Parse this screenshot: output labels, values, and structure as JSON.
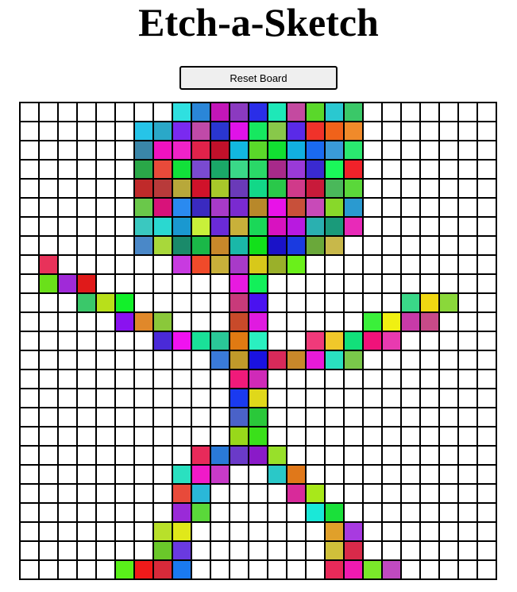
{
  "title": "Etch-a-Sketch",
  "reset_button": {
    "label": "Reset Board"
  },
  "board": {
    "size": 25,
    "default_color": "#ffffff",
    "painted": [
      [
        0,
        8,
        "#2fe0e0"
      ],
      [
        0,
        9,
        "#2a86d8"
      ],
      [
        0,
        10,
        "#c316b8"
      ],
      [
        0,
        11,
        "#8b3ac0"
      ],
      [
        0,
        12,
        "#2a2ee8"
      ],
      [
        0,
        13,
        "#1ee8b8"
      ],
      [
        0,
        14,
        "#c44aa0"
      ],
      [
        0,
        15,
        "#5ad82a"
      ],
      [
        0,
        16,
        "#2ac8d0"
      ],
      [
        0,
        17,
        "#3ac868"
      ],
      [
        1,
        6,
        "#26c4e8"
      ],
      [
        1,
        7,
        "#2aa8c8"
      ],
      [
        1,
        8,
        "#7a2af0"
      ],
      [
        1,
        9,
        "#c04aa8"
      ],
      [
        1,
        10,
        "#2a36d0"
      ],
      [
        1,
        11,
        "#e012e8"
      ],
      [
        1,
        12,
        "#16e860"
      ],
      [
        1,
        13,
        "#88c84a"
      ],
      [
        1,
        14,
        "#5a2ae8"
      ],
      [
        1,
        15,
        "#f0322a"
      ],
      [
        1,
        16,
        "#f0621a"
      ],
      [
        1,
        17,
        "#f08a2a"
      ],
      [
        2,
        6,
        "#3a86a8"
      ],
      [
        2,
        7,
        "#f012c0"
      ],
      [
        2,
        8,
        "#f022c8"
      ],
      [
        2,
        9,
        "#e0224a"
      ],
      [
        2,
        10,
        "#c0102a"
      ],
      [
        2,
        11,
        "#12b8e0"
      ],
      [
        2,
        12,
        "#5ad82a"
      ],
      [
        2,
        13,
        "#12e032"
      ],
      [
        2,
        14,
        "#12b0e0"
      ],
      [
        2,
        15,
        "#1a6af0"
      ],
      [
        2,
        16,
        "#3a9ad8"
      ],
      [
        2,
        17,
        "#2ae870"
      ],
      [
        3,
        6,
        "#2aa848"
      ],
      [
        3,
        7,
        "#e84a3a"
      ],
      [
        3,
        8,
        "#12e03a"
      ],
      [
        3,
        9,
        "#7a4ad0"
      ],
      [
        3,
        10,
        "#1aa868"
      ],
      [
        3,
        11,
        "#3ad888"
      ],
      [
        3,
        12,
        "#2ad868"
      ],
      [
        3,
        13,
        "#a82a8a"
      ],
      [
        3,
        14,
        "#9a3ad8"
      ],
      [
        3,
        15,
        "#3a2ad0"
      ],
      [
        3,
        16,
        "#1af85a"
      ],
      [
        3,
        17,
        "#f0222a"
      ],
      [
        4,
        6,
        "#c02a2a"
      ],
      [
        4,
        7,
        "#b83a3a"
      ],
      [
        4,
        8,
        "#b8a83a"
      ],
      [
        4,
        9,
        "#d0122a"
      ],
      [
        4,
        10,
        "#a8c82a"
      ],
      [
        4,
        11,
        "#6a3ab8"
      ],
      [
        4,
        12,
        "#12d888"
      ],
      [
        4,
        13,
        "#2ac84a"
      ],
      [
        4,
        14,
        "#d03a8a"
      ],
      [
        4,
        15,
        "#c81a3a"
      ],
      [
        4,
        16,
        "#4ab85a"
      ],
      [
        4,
        17,
        "#5ad83a"
      ],
      [
        5,
        6,
        "#6ac84a"
      ],
      [
        5,
        7,
        "#d8127a"
      ],
      [
        5,
        8,
        "#2a8af0"
      ],
      [
        5,
        9,
        "#3a2ac0"
      ],
      [
        5,
        10,
        "#a83ac8"
      ],
      [
        5,
        11,
        "#7a2ad0"
      ],
      [
        5,
        12,
        "#b8882a"
      ],
      [
        5,
        13,
        "#e812e8"
      ],
      [
        5,
        14,
        "#c8503a"
      ],
      [
        5,
        15,
        "#c84ab8"
      ],
      [
        5,
        16,
        "#88d82a"
      ],
      [
        5,
        17,
        "#2a9ad0"
      ],
      [
        6,
        6,
        "#3ac8c0"
      ],
      [
        6,
        7,
        "#2ad8d0"
      ],
      [
        6,
        8,
        "#1a98d0"
      ],
      [
        6,
        9,
        "#c8f03a"
      ],
      [
        6,
        10,
        "#6a2ad8"
      ],
      [
        6,
        11,
        "#c8b03a"
      ],
      [
        6,
        12,
        "#1ad858"
      ],
      [
        6,
        13,
        "#d812c0"
      ],
      [
        6,
        14,
        "#b81ae0"
      ],
      [
        6,
        15,
        "#2ab0b0"
      ],
      [
        6,
        16,
        "#1a9a7a"
      ],
      [
        6,
        17,
        "#e82ab8"
      ],
      [
        7,
        6,
        "#4a88c8"
      ],
      [
        7,
        7,
        "#a8d83a"
      ],
      [
        7,
        8,
        "#1a8a6a"
      ],
      [
        7,
        9,
        "#1ab848"
      ],
      [
        7,
        10,
        "#c8882a"
      ],
      [
        7,
        11,
        "#1ab8a8"
      ],
      [
        7,
        12,
        "#12e01a"
      ],
      [
        7,
        13,
        "#1a12c8"
      ],
      [
        7,
        14,
        "#1a3ae0"
      ],
      [
        7,
        15,
        "#6aa83a"
      ],
      [
        7,
        16,
        "#c8b84a"
      ],
      [
        8,
        1,
        "#e8325a"
      ],
      [
        8,
        8,
        "#c83ae0"
      ],
      [
        8,
        9,
        "#f04a2a"
      ],
      [
        8,
        10,
        "#c8b03a"
      ],
      [
        8,
        11,
        "#a83ac8"
      ],
      [
        8,
        12,
        "#d8c81a"
      ],
      [
        8,
        13,
        "#9ab02a"
      ],
      [
        8,
        14,
        "#6af01a"
      ],
      [
        9,
        1,
        "#6ae01a"
      ],
      [
        9,
        2,
        "#a02ad8"
      ],
      [
        9,
        3,
        "#e01a1a"
      ],
      [
        9,
        11,
        "#e81ae0"
      ],
      [
        9,
        12,
        "#12f05a"
      ],
      [
        10,
        3,
        "#3ac86a"
      ],
      [
        10,
        4,
        "#b8e01a"
      ],
      [
        10,
        5,
        "#12f02a"
      ],
      [
        10,
        11,
        "#c83a7a"
      ],
      [
        10,
        12,
        "#4a12f0"
      ],
      [
        10,
        20,
        "#3ad888"
      ],
      [
        10,
        21,
        "#f0d812"
      ],
      [
        10,
        22,
        "#8ad83a"
      ],
      [
        11,
        5,
        "#8a12f0"
      ],
      [
        11,
        6,
        "#e0882a"
      ],
      [
        11,
        7,
        "#8ac83a"
      ],
      [
        11,
        11,
        "#c84a2a"
      ],
      [
        11,
        12,
        "#e01ae0"
      ],
      [
        11,
        18,
        "#3af03a"
      ],
      [
        11,
        19,
        "#f0f012"
      ],
      [
        11,
        20,
        "#c83aa8"
      ],
      [
        11,
        21,
        "#c84a88"
      ],
      [
        12,
        7,
        "#4a2ad8"
      ],
      [
        12,
        8,
        "#f012f0"
      ],
      [
        12,
        9,
        "#1ae098"
      ],
      [
        12,
        10,
        "#2ac898"
      ],
      [
        12,
        11,
        "#e07a12"
      ],
      [
        12,
        12,
        "#2af0c0"
      ],
      [
        12,
        15,
        "#f03a7a"
      ],
      [
        12,
        16,
        "#f0c82a"
      ],
      [
        12,
        17,
        "#12e07a"
      ],
      [
        12,
        18,
        "#f0127a"
      ],
      [
        12,
        19,
        "#e83ab0"
      ],
      [
        13,
        10,
        "#3a7ad8"
      ],
      [
        13,
        11,
        "#c09a2a"
      ],
      [
        13,
        12,
        "#1a12e0"
      ],
      [
        13,
        13,
        "#d82a5a"
      ],
      [
        13,
        14,
        "#c8882a"
      ],
      [
        13,
        15,
        "#e81ad8"
      ],
      [
        13,
        16,
        "#2ae0c0"
      ],
      [
        13,
        17,
        "#7ac84a"
      ],
      [
        14,
        11,
        "#f01a7a"
      ],
      [
        14,
        12,
        "#d02ab8"
      ],
      [
        15,
        11,
        "#1a3af0"
      ],
      [
        15,
        12,
        "#e0d81a"
      ],
      [
        16,
        11,
        "#4a62c8"
      ],
      [
        16,
        12,
        "#2ac83a"
      ],
      [
        17,
        11,
        "#98d81a"
      ],
      [
        17,
        12,
        "#3ae01a"
      ],
      [
        18,
        9,
        "#e82a5a"
      ],
      [
        18,
        10,
        "#2a7ad8"
      ],
      [
        18,
        11,
        "#6a3ac8"
      ],
      [
        18,
        12,
        "#8a1ac8"
      ],
      [
        18,
        13,
        "#98e02a"
      ],
      [
        19,
        8,
        "#2ae0c0"
      ],
      [
        19,
        9,
        "#f01ac8"
      ],
      [
        19,
        10,
        "#c83ac8"
      ],
      [
        19,
        13,
        "#2ac8c8"
      ],
      [
        19,
        14,
        "#e0781a"
      ],
      [
        20,
        8,
        "#e84a3a"
      ],
      [
        20,
        9,
        "#2ab8d8"
      ],
      [
        20,
        14,
        "#d82a9a"
      ],
      [
        20,
        15,
        "#a8e81a"
      ],
      [
        21,
        8,
        "#9a2ad8"
      ],
      [
        21,
        9,
        "#5ad83a"
      ],
      [
        21,
        15,
        "#1ae8d8"
      ],
      [
        21,
        16,
        "#1ae03a"
      ],
      [
        22,
        7,
        "#b8e02a"
      ],
      [
        22,
        8,
        "#e0e81a"
      ],
      [
        22,
        16,
        "#e0a02a"
      ],
      [
        22,
        17,
        "#a83ae0"
      ],
      [
        23,
        7,
        "#6ac82a"
      ],
      [
        23,
        8,
        "#6a3ae0"
      ],
      [
        23,
        16,
        "#d0c03a"
      ],
      [
        23,
        17,
        "#d82a4a"
      ],
      [
        24,
        5,
        "#5af01a"
      ],
      [
        24,
        6,
        "#f01a1a"
      ],
      [
        24,
        7,
        "#d82a3a"
      ],
      [
        24,
        8,
        "#1a7af0"
      ],
      [
        24,
        16,
        "#e82a5a"
      ],
      [
        24,
        17,
        "#f01ab0"
      ],
      [
        24,
        18,
        "#7ae82a"
      ],
      [
        24,
        19,
        "#c04ac0"
      ]
    ]
  }
}
